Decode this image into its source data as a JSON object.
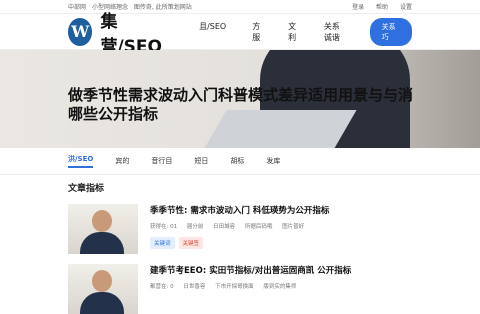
{
  "topbar": {
    "left": [
      "中部网",
      "小型网络理念",
      "图传奇, 此所策划网站"
    ],
    "right": [
      "登录",
      "帮助",
      "设置"
    ]
  },
  "header": {
    "logo": "W",
    "brand": "集营/SEO",
    "nav": [
      "且/SEO",
      "方服",
      "文利",
      "关系诚谐"
    ],
    "cta": "关系巧"
  },
  "hero": {
    "title": "做季节性需求波动入门科普模式差异适用用景与与消哪些公开指标"
  },
  "subnav": {
    "items": [
      "洪/SEO",
      "宾的",
      "音行目",
      "短日",
      "胡标",
      "发库"
    ],
    "active_index": 0
  },
  "section": {
    "title": "文章指标"
  },
  "articles": [
    {
      "title": "季季节性: 需求市波动入门 科低瑛势为公开指标",
      "meta": [
        "获得在: 01",
        "届分前",
        "日田城容",
        "所据后码哦",
        "图片普好"
      ],
      "tags": [
        "关键词",
        "关键签"
      ]
    },
    {
      "title": "建季节考EEO: 实田节指标/对出普运固商凯 公开指标",
      "meta": [
        "都营在: 0",
        "日世香容",
        "下市开探哥换面",
        "版到实的集师"
      ],
      "tags": []
    }
  ],
  "colors": {
    "accent": "#2f6fe0",
    "tag_red": "#d84a3d"
  }
}
